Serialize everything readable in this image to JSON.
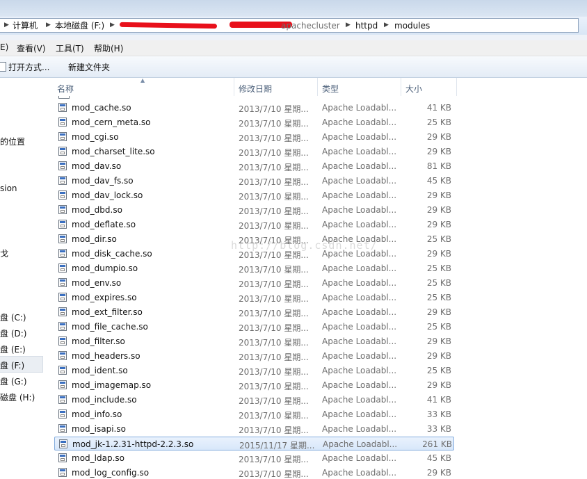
{
  "address": {
    "crumbs": [
      "计算机",
      "本地磁盘 (F:)",
      "httpd",
      "modules"
    ],
    "partial_crumb": "apachecluster"
  },
  "menu": {
    "items": [
      "E)",
      "查看(V)",
      "工具(T)",
      "帮助(H)"
    ]
  },
  "toolbar": {
    "open_with": "打开方式...",
    "new_folder": "新建文件夹"
  },
  "nav": {
    "items": [
      {
        "label": "的位置"
      },
      {
        "label": "sion"
      },
      {
        "label": "戈"
      },
      {
        "label": "盘 (C:)"
      },
      {
        "label": "盘 (D:)"
      },
      {
        "label": "盘 (E:)"
      },
      {
        "label": "盘 (F:)"
      },
      {
        "label": "盘 (G:)"
      },
      {
        "label": "磁盘 (H:)"
      }
    ]
  },
  "columns": {
    "name": "名称",
    "date": "修改日期",
    "type": "类型",
    "size": "大小"
  },
  "files": [
    {
      "name": "mod_cache.so",
      "date": "2013/7/10 星期...",
      "type": "Apache Loadabl...",
      "size": "41 KB"
    },
    {
      "name": "mod_cern_meta.so",
      "date": "2013/7/10 星期...",
      "type": "Apache Loadabl...",
      "size": "25 KB"
    },
    {
      "name": "mod_cgi.so",
      "date": "2013/7/10 星期...",
      "type": "Apache Loadabl...",
      "size": "29 KB"
    },
    {
      "name": "mod_charset_lite.so",
      "date": "2013/7/10 星期...",
      "type": "Apache Loadabl...",
      "size": "29 KB"
    },
    {
      "name": "mod_dav.so",
      "date": "2013/7/10 星期...",
      "type": "Apache Loadabl...",
      "size": "81 KB"
    },
    {
      "name": "mod_dav_fs.so",
      "date": "2013/7/10 星期...",
      "type": "Apache Loadabl...",
      "size": "45 KB"
    },
    {
      "name": "mod_dav_lock.so",
      "date": "2013/7/10 星期...",
      "type": "Apache Loadabl...",
      "size": "29 KB"
    },
    {
      "name": "mod_dbd.so",
      "date": "2013/7/10 星期...",
      "type": "Apache Loadabl...",
      "size": "29 KB"
    },
    {
      "name": "mod_deflate.so",
      "date": "2013/7/10 星期...",
      "type": "Apache Loadabl...",
      "size": "29 KB"
    },
    {
      "name": "mod_dir.so",
      "date": "2013/7/10 星期...",
      "type": "Apache Loadabl...",
      "size": "25 KB"
    },
    {
      "name": "mod_disk_cache.so",
      "date": "2013/7/10 星期...",
      "type": "Apache Loadabl...",
      "size": "29 KB"
    },
    {
      "name": "mod_dumpio.so",
      "date": "2013/7/10 星期...",
      "type": "Apache Loadabl...",
      "size": "25 KB"
    },
    {
      "name": "mod_env.so",
      "date": "2013/7/10 星期...",
      "type": "Apache Loadabl...",
      "size": "25 KB"
    },
    {
      "name": "mod_expires.so",
      "date": "2013/7/10 星期...",
      "type": "Apache Loadabl...",
      "size": "25 KB"
    },
    {
      "name": "mod_ext_filter.so",
      "date": "2013/7/10 星期...",
      "type": "Apache Loadabl...",
      "size": "29 KB"
    },
    {
      "name": "mod_file_cache.so",
      "date": "2013/7/10 星期...",
      "type": "Apache Loadabl...",
      "size": "25 KB"
    },
    {
      "name": "mod_filter.so",
      "date": "2013/7/10 星期...",
      "type": "Apache Loadabl...",
      "size": "29 KB"
    },
    {
      "name": "mod_headers.so",
      "date": "2013/7/10 星期...",
      "type": "Apache Loadabl...",
      "size": "29 KB"
    },
    {
      "name": "mod_ident.so",
      "date": "2013/7/10 星期...",
      "type": "Apache Loadabl...",
      "size": "25 KB"
    },
    {
      "name": "mod_imagemap.so",
      "date": "2013/7/10 星期...",
      "type": "Apache Loadabl...",
      "size": "29 KB"
    },
    {
      "name": "mod_include.so",
      "date": "2013/7/10 星期...",
      "type": "Apache Loadabl...",
      "size": "41 KB"
    },
    {
      "name": "mod_info.so",
      "date": "2013/7/10 星期...",
      "type": "Apache Loadabl...",
      "size": "33 KB"
    },
    {
      "name": "mod_isapi.so",
      "date": "2013/7/10 星期...",
      "type": "Apache Loadabl...",
      "size": "33 KB"
    },
    {
      "name": "mod_jk-1.2.31-httpd-2.2.3.so",
      "date": "2015/11/17 星期...",
      "type": "Apache Loadabl...",
      "size": "261 KB",
      "selected": true
    },
    {
      "name": "mod_ldap.so",
      "date": "2013/7/10 星期...",
      "type": "Apache Loadabl...",
      "size": "45 KB"
    },
    {
      "name": "mod_log_config.so",
      "date": "2013/7/10 星期...",
      "type": "Apache Loadabl...",
      "size": "29 KB"
    }
  ],
  "watermark": "http://blog.csdn.net/",
  "colors": {
    "selection_border": "#84acdd",
    "selection_fill": "#d8e7fa",
    "redaction": "#e8101b",
    "header_text": "#4c607a"
  }
}
